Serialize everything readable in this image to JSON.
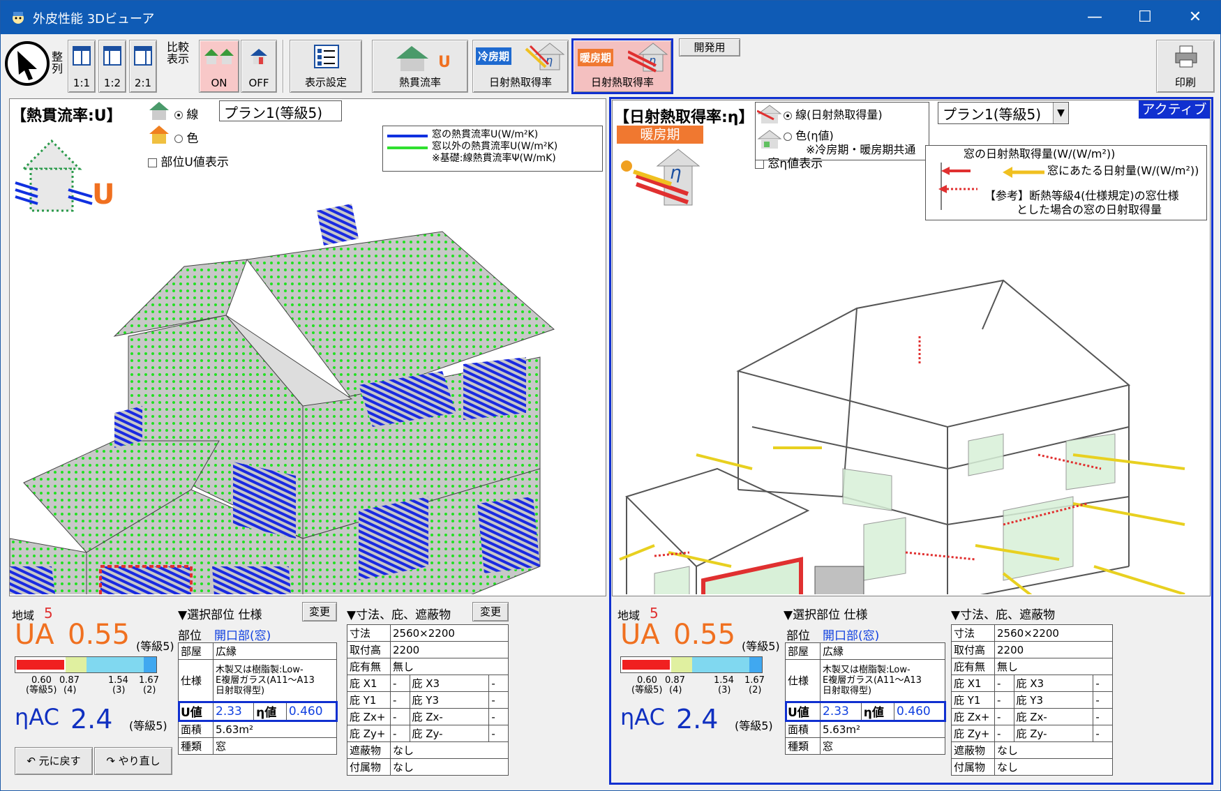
{
  "window": {
    "title": "外皮性能 3Dビューア"
  },
  "toolbar": {
    "align_label": "整列",
    "ratio_11": "1:1",
    "ratio_12": "1:2",
    "ratio_21": "2:1",
    "compare_label": "比較表示",
    "on_label": "ON",
    "off_label": "OFF",
    "display_settings": "表示設定",
    "thermal_transmittance": "熱貫流率",
    "cooling_badge": "冷房期",
    "cooling_solar": "日射熱取得率",
    "heating_badge": "暖房期",
    "heating_solar": "日射熱取得率",
    "dev_label": "開発用",
    "print_label": "印刷"
  },
  "left": {
    "title": "【熱貫流率:U】",
    "opt_line": "線",
    "opt_color": "色",
    "plan": "プラン1(等級5)",
    "show_u": "部位U値表示",
    "legend1": "窓の熱貫流率U(W/m²K)",
    "legend2": "窓以外の熱貫流率U(W/m²K)",
    "legend3": "※基礎:線熱貫流率Ψ(W/mK)"
  },
  "right": {
    "title": "【日射熱取得率:η】",
    "season": "暖房期",
    "opt_line": "線(日射熱取得量)",
    "opt_color": "色(η値)",
    "opt_note": "※冷房期・暖房期共通",
    "plan": "プラン1(等級5)",
    "active": "アクティブ",
    "show_eta": "窓η値表示",
    "legend1": "窓の日射熱取得量(W/(W/m²))",
    "legend2": "窓にあたる日射量(W/(W/m²))",
    "legend3": "【参考】断熱等級4(仕様規定)の窓仕様",
    "legend4": "とした場合の窓の日射取得量"
  },
  "info": {
    "region_label": "地域",
    "region_value": "5",
    "ua_label": "UA",
    "ua_value": "0.55",
    "grade": "(等級5)",
    "scale_060": "0.60",
    "scale_087": "0.87",
    "scale_154": "1.54",
    "scale_167": "1.67",
    "scale_g5": "(等級5)",
    "scale_g4": "(4)",
    "scale_g3": "(3)",
    "scale_g2": "(2)",
    "eta_label": "ηAC",
    "eta_value": "2.4",
    "undo": "元に戻す",
    "redo": "やり直し",
    "sel_header": "▼選択部位 仕様",
    "change": "変更",
    "dim_header": "▼寸法、庇、遮蔽物",
    "part_label": "部位",
    "part_value": "開口部(窓)",
    "room_label": "部屋",
    "room_value": "広縁",
    "spec_label": "仕様",
    "spec_value1": "木製又は樹脂製:Low-",
    "spec_value2": "E複層ガラス(A11～A13",
    "spec_value3": "日射取得型)",
    "u_label": "U値",
    "u_value": "2.33",
    "eta_cell_label": "η値",
    "eta_cell_value": "0.460",
    "area_label": "面積",
    "area_value": "5.63m²",
    "type_label": "種類",
    "type_value": "窓",
    "size_label": "寸法",
    "size_value": "2560×2200",
    "height_label": "取付高",
    "height_value": "2200",
    "eave_label": "庇有無",
    "eave_value": "無し",
    "x1": "庇 X1",
    "x3": "庇 X3",
    "y1": "庇 Y1",
    "y3": "庇 Y3",
    "zxp": "庇 Zx+",
    "zxm": "庇 Zx-",
    "zyp": "庇 Zy+",
    "zym": "庇 Zy-",
    "dash": "-",
    "shield_label": "遮蔽物",
    "shield_value": "なし",
    "attach_label": "付属物",
    "attach_value": "なし"
  },
  "colors": {
    "accent": "#0f5bb5",
    "ua": "#f07020",
    "eta": "#1030c0",
    "active_border": "#1030d0"
  }
}
